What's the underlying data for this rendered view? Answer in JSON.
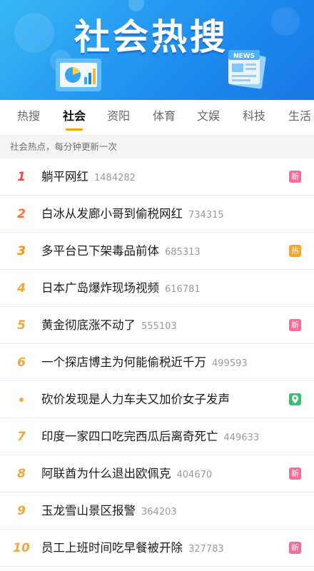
{
  "banner": {
    "title": "社会热搜",
    "news_label": "NEWS",
    "colors": {
      "start": "#37b8f4",
      "end": "#1877e6"
    }
  },
  "tabs": [
    {
      "label": "热搜",
      "active": false
    },
    {
      "label": "社会",
      "active": true
    },
    {
      "label": "资阳",
      "active": false
    },
    {
      "label": "体育",
      "active": false
    },
    {
      "label": "文娱",
      "active": false
    },
    {
      "label": "科技",
      "active": false
    },
    {
      "label": "生活",
      "active": false
    }
  ],
  "hint": "社会热点，每分钟更新一次",
  "list": [
    {
      "rank": "1",
      "title": "躺平网红",
      "count": "1484282",
      "badge": "新",
      "badge_type": "new"
    },
    {
      "rank": "2",
      "title": "白冰从发廊小哥到偷税网红",
      "count": "734315",
      "badge": "",
      "badge_type": ""
    },
    {
      "rank": "3",
      "title": "多平台已下架毒品前体",
      "count": "685313",
      "badge": "热",
      "badge_type": "hot"
    },
    {
      "rank": "4",
      "title": "日本广岛爆炸现场视频",
      "count": "616781",
      "badge": "",
      "badge_type": ""
    },
    {
      "rank": "5",
      "title": "黄金彻底涨不动了",
      "count": "555103",
      "badge": "新",
      "badge_type": "new"
    },
    {
      "rank": "6",
      "title": "一个探店博主为何能偷税近千万",
      "count": "499593",
      "badge": "",
      "badge_type": ""
    },
    {
      "rank": "",
      "title": "砍价发现是人力车夫又加价女子发声",
      "count": "",
      "badge": "",
      "badge_type": "loc"
    },
    {
      "rank": "7",
      "title": "印度一家四口吃完西瓜后离奇死亡",
      "count": "449633",
      "badge": "",
      "badge_type": ""
    },
    {
      "rank": "8",
      "title": "阿联酋为什么退出欧佩克",
      "count": "404670",
      "badge": "新",
      "badge_type": "new"
    },
    {
      "rank": "9",
      "title": "玉龙雪山景区报警",
      "count": "364203",
      "badge": "",
      "badge_type": ""
    },
    {
      "rank": "10",
      "title": "员工上班时间吃早餐被开除",
      "count": "327783",
      "badge": "新",
      "badge_type": "new"
    }
  ],
  "colors": {
    "tab_indicator": "#f5a300",
    "rank_1": "#f0494b",
    "rank_2": "#ff6f3c",
    "rank_3": "#ff8e00",
    "rank_other": "#f3a43b",
    "badge_new": "#f56a9a",
    "badge_hot": "#f8a51b",
    "badge_loc": "#3cbd6e"
  }
}
